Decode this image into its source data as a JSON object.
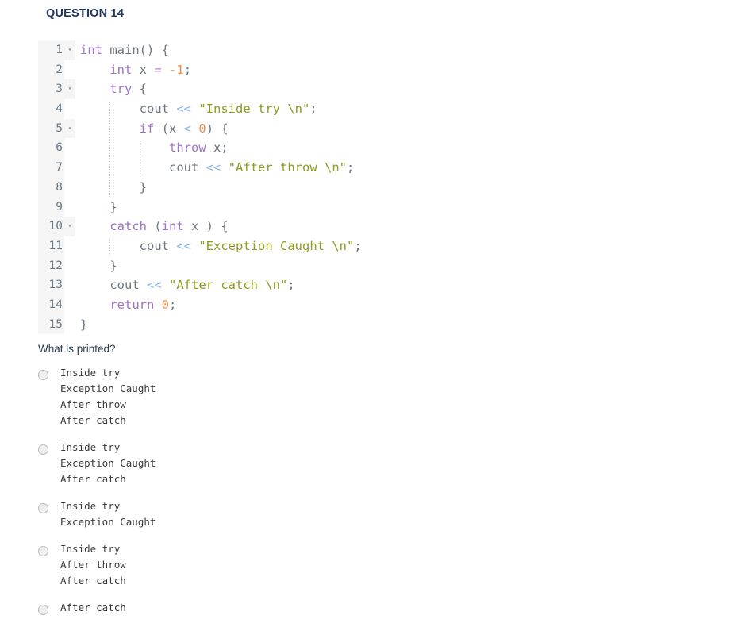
{
  "header": {
    "question_label": "QUESTION 14"
  },
  "code": {
    "language": "cpp",
    "lines": [
      {
        "number": "1",
        "foldable": true,
        "indent": 0,
        "tokens": [
          {
            "t": "int",
            "c": "kw"
          },
          {
            "t": " main() {",
            "c": "pl"
          }
        ]
      },
      {
        "number": "2",
        "foldable": false,
        "indent": 1,
        "tokens": [
          {
            "t": "int",
            "c": "kw"
          },
          {
            "t": " x ",
            "c": "pl"
          },
          {
            "t": "=",
            "c": "eq"
          },
          {
            "t": " ",
            "c": "pl"
          },
          {
            "t": "-1",
            "c": "num"
          },
          {
            "t": ";",
            "c": "pl"
          }
        ]
      },
      {
        "number": "3",
        "foldable": true,
        "indent": 1,
        "tokens": [
          {
            "t": "try",
            "c": "kw"
          },
          {
            "t": " {",
            "c": "pl"
          }
        ]
      },
      {
        "number": "4",
        "foldable": false,
        "indent": 2,
        "tokens": [
          {
            "t": "cout ",
            "c": "pl"
          },
          {
            "t": "<<",
            "c": "op"
          },
          {
            "t": " ",
            "c": "pl"
          },
          {
            "t": "\"Inside try \\n\"",
            "c": "str"
          },
          {
            "t": ";",
            "c": "pl"
          }
        ]
      },
      {
        "number": "5",
        "foldable": true,
        "indent": 2,
        "tokens": [
          {
            "t": "if",
            "c": "kw"
          },
          {
            "t": " (x ",
            "c": "pl"
          },
          {
            "t": "<",
            "c": "op"
          },
          {
            "t": " ",
            "c": "pl"
          },
          {
            "t": "0",
            "c": "num"
          },
          {
            "t": ") {",
            "c": "pl"
          }
        ]
      },
      {
        "number": "6",
        "foldable": false,
        "indent": 3,
        "tokens": [
          {
            "t": "throw",
            "c": "kw"
          },
          {
            "t": " x;",
            "c": "pl"
          }
        ]
      },
      {
        "number": "7",
        "foldable": false,
        "indent": 3,
        "tokens": [
          {
            "t": "cout ",
            "c": "pl"
          },
          {
            "t": "<<",
            "c": "op"
          },
          {
            "t": " ",
            "c": "pl"
          },
          {
            "t": "\"After throw \\n\"",
            "c": "str"
          },
          {
            "t": ";",
            "c": "pl"
          }
        ]
      },
      {
        "number": "8",
        "foldable": false,
        "indent": 2,
        "tokens": [
          {
            "t": "}",
            "c": "pl"
          }
        ]
      },
      {
        "number": "9",
        "foldable": false,
        "indent": 1,
        "tokens": [
          {
            "t": "}",
            "c": "pl"
          }
        ]
      },
      {
        "number": "10",
        "foldable": true,
        "indent": 1,
        "tokens": [
          {
            "t": "catch",
            "c": "kw"
          },
          {
            "t": " (",
            "c": "pl"
          },
          {
            "t": "int",
            "c": "kw"
          },
          {
            "t": " x ) {",
            "c": "pl"
          }
        ]
      },
      {
        "number": "11",
        "foldable": false,
        "indent": 2,
        "tokens": [
          {
            "t": "cout ",
            "c": "pl"
          },
          {
            "t": "<<",
            "c": "op"
          },
          {
            "t": " ",
            "c": "pl"
          },
          {
            "t": "\"Exception Caught \\n\"",
            "c": "str"
          },
          {
            "t": ";",
            "c": "pl"
          }
        ]
      },
      {
        "number": "12",
        "foldable": false,
        "indent": 1,
        "tokens": [
          {
            "t": "}",
            "c": "pl"
          }
        ]
      },
      {
        "number": "13",
        "foldable": false,
        "indent": 1,
        "tokens": [
          {
            "t": "cout ",
            "c": "pl"
          },
          {
            "t": "<<",
            "c": "op"
          },
          {
            "t": " ",
            "c": "pl"
          },
          {
            "t": "\"After catch \\n\"",
            "c": "str"
          },
          {
            "t": ";",
            "c": "pl"
          }
        ]
      },
      {
        "number": "14",
        "foldable": false,
        "indent": 1,
        "tokens": [
          {
            "t": "return",
            "c": "kw"
          },
          {
            "t": " ",
            "c": "pl"
          },
          {
            "t": "0",
            "c": "num"
          },
          {
            "t": ";",
            "c": "pl"
          }
        ]
      },
      {
        "number": "15",
        "foldable": false,
        "indent": 0,
        "tokens": [
          {
            "t": "}",
            "c": "pl"
          }
        ]
      }
    ],
    "fold_marker": "▾",
    "colors": {
      "keyword": "#a071c8",
      "plain": "#6e7781",
      "string": "#8f9a1f",
      "number": "#f08d49",
      "operator": "#8ab4e8",
      "gutter_bg": "#f5f5f5",
      "gutter_fg": "#6b7a86"
    }
  },
  "prompt": {
    "text": "What is printed?"
  },
  "options": [
    {
      "id": "option-a",
      "selected": false,
      "lines": [
        "Inside try",
        "Exception Caught",
        "After throw",
        "After catch"
      ]
    },
    {
      "id": "option-b",
      "selected": false,
      "lines": [
        "Inside try",
        "Exception Caught",
        "After catch"
      ]
    },
    {
      "id": "option-c",
      "selected": false,
      "lines": [
        "Inside try",
        "Exception Caught"
      ]
    },
    {
      "id": "option-d",
      "selected": false,
      "lines": [
        "Inside try",
        "After throw",
        "After catch"
      ]
    },
    {
      "id": "option-e",
      "selected": false,
      "lines": [
        "After catch"
      ]
    }
  ]
}
